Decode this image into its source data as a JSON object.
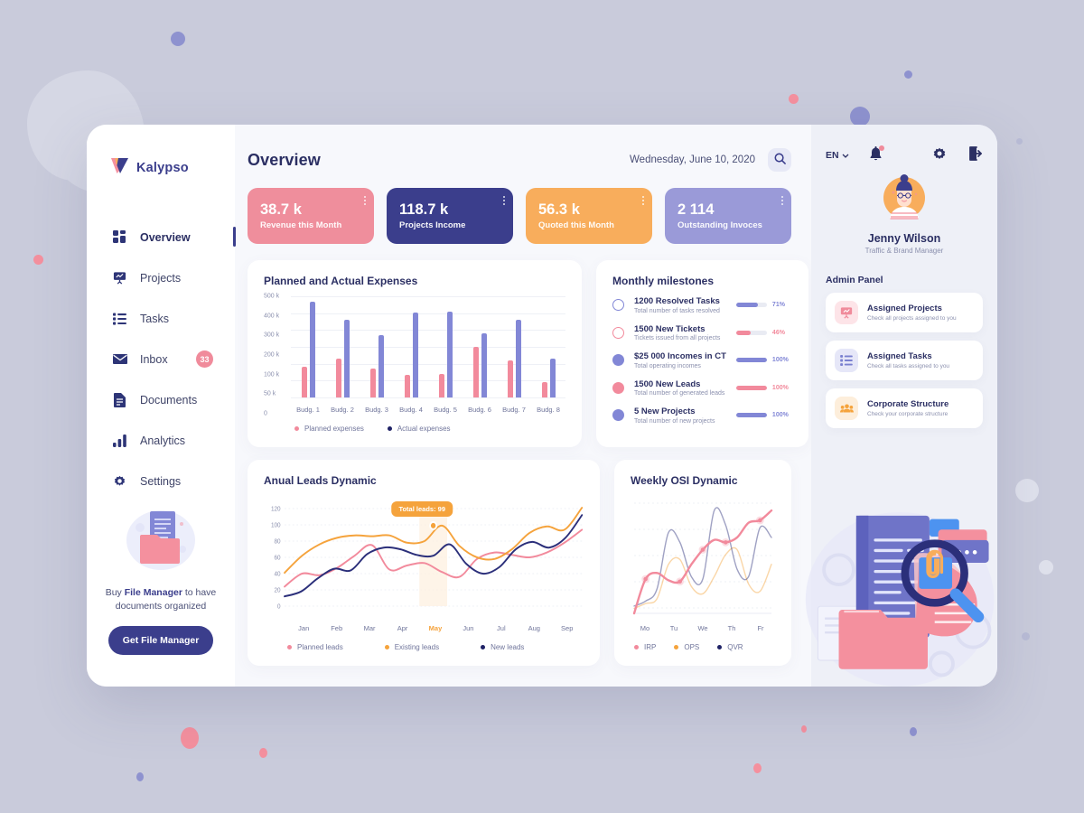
{
  "background": {
    "base_color": "#c9cbdb",
    "blob_color": "#d5d7e4"
  },
  "brand": {
    "name": "Kalypso",
    "logo_icon": "kalypso-v-logo"
  },
  "sidebar": {
    "items": [
      {
        "label": "Overview",
        "icon": "grid-icon",
        "active": true
      },
      {
        "label": "Projects",
        "icon": "presentation-icon",
        "active": false
      },
      {
        "label": "Tasks",
        "icon": "list-icon",
        "active": false
      },
      {
        "label": "Inbox",
        "icon": "envelope-icon",
        "active": false,
        "badge": "33"
      },
      {
        "label": "Documents",
        "icon": "document-icon",
        "active": false
      },
      {
        "label": "Analytics",
        "icon": "bar-chart-icon",
        "active": false
      },
      {
        "label": "Settings",
        "icon": "gear-icon",
        "active": false
      }
    ],
    "promo": {
      "art_icon": "file-manager-illustration",
      "text_before": "Buy ",
      "text_bold": "File Manager",
      "text_after": " to have documents organized",
      "button_label": "Get File Manager"
    }
  },
  "header": {
    "title": "Overview",
    "date": "Wednesday, June 10, 2020",
    "search_icon": "search-icon"
  },
  "kpis": [
    {
      "value": "38.7 k",
      "label": "Revenue this Month",
      "color": "#ef8e9c"
    },
    {
      "value": "118.7 k",
      "label": "Projects Income",
      "color": "#3b3e8c"
    },
    {
      "value": "56.3 k",
      "label": "Quoted this Month",
      "color": "#f8ad5c"
    },
    {
      "value": "2 114",
      "label": "Outstanding Invoces",
      "color": "#9a9ad8"
    }
  ],
  "milestones": {
    "title": "Monthly milestones",
    "items": [
      {
        "title": "1200 Resolved Tasks",
        "sub": "Total number of tasks resolved",
        "pct": 71,
        "pct_label": "71%",
        "color": "#8287d6",
        "filled": false
      },
      {
        "title": "1500 New Tickets",
        "sub": "Tickets issued from all projects",
        "pct": 46,
        "pct_label": "46%",
        "color": "#f28a9c",
        "filled": false
      },
      {
        "title": "$25 000 Incomes in CT",
        "sub": "Total operating incomes",
        "pct": 100,
        "pct_label": "100%",
        "color": "#8287d6",
        "filled": true
      },
      {
        "title": "1500 New Leads",
        "sub": "Total number of generated leads",
        "pct": 100,
        "pct_label": "100%",
        "color": "#f28a9c",
        "filled": true
      },
      {
        "title": "5 New Projects",
        "sub": "Total number of new projects",
        "pct": 100,
        "pct_label": "100%",
        "color": "#8287d6",
        "filled": true
      }
    ]
  },
  "right_panel": {
    "language": "EN",
    "chevron_icon": "chevron-down-icon",
    "bell_icon": "bell-icon",
    "gear_icon": "gear-icon",
    "logout_icon": "logout-icon",
    "user": {
      "name": "Jenny Wilson",
      "role": "Traffic & Brand Manager",
      "avatar_icon": "avatar-illustration"
    },
    "admin_heading": "Admin Panel",
    "admin_items": [
      {
        "title": "Assigned Projects",
        "sub": "Check all projects assigned to you",
        "icon": "presentation-icon",
        "bg": "#fde4e8",
        "fg": "#f08b9b"
      },
      {
        "title": "Assigned Tasks",
        "sub": "Check all tasks assigned to you",
        "icon": "list-icon",
        "bg": "#e6e7f8",
        "fg": "#7a80d0"
      },
      {
        "title": "Corporate Structure",
        "sub": "Check your corporate structure",
        "icon": "people-icon",
        "bg": "#fdeedb",
        "fg": "#f5a33c"
      }
    ],
    "illustration_icon": "document-search-illustration"
  },
  "chart_data": [
    {
      "type": "bar",
      "title": "Planned and Actual Expenses",
      "categories": [
        "Budg. 1",
        "Budg. 2",
        "Budg. 3",
        "Budg. 4",
        "Budg. 5",
        "Budg. 6",
        "Budg. 7",
        "Budg. 8"
      ],
      "series": [
        {
          "name": "Planned expenses",
          "color": "#f28a9c",
          "values": [
            90,
            128,
            85,
            68,
            69,
            200,
            118,
            45
          ]
        },
        {
          "name": "Actual expenses",
          "color": "#8287d6",
          "values": [
            470,
            362,
            268,
            405,
            407,
            278,
            362,
            128
          ]
        }
      ],
      "yticks": [
        "500 k",
        "400 k",
        "300 k",
        "200 k",
        "100 k",
        "50 k",
        "0"
      ],
      "ylim": [
        0,
        500
      ],
      "ylabel": "",
      "xlabel": "",
      "grid": true,
      "legend_position": "bottom",
      "legend_dot_colors": {
        "Planned expenses": "#f28a9c",
        "Actual expenses": "#1f2266"
      }
    },
    {
      "type": "line",
      "title": "Anual Leads Dynamic",
      "x": [
        "Jan",
        "Feb",
        "Mar",
        "Apr",
        "May",
        "Jun",
        "Jul",
        "Aug",
        "Sep"
      ],
      "highlight_x": "May",
      "yticks": [
        "120",
        "100",
        "80",
        "60",
        "40",
        "20",
        "0"
      ],
      "ylim": [
        0,
        120
      ],
      "grid": true,
      "annotation": {
        "text": "Total leads: 99",
        "x": "May",
        "y": 99,
        "color": "#f5a33c"
      },
      "series": [
        {
          "name": "Planned leads",
          "color": "#f28a9c",
          "values": [
            24,
            40,
            38,
            47,
            62,
            75,
            45,
            50,
            53,
            42,
            36,
            58,
            66,
            63,
            60,
            66,
            78,
            94
          ]
        },
        {
          "name": "Existing leads",
          "color": "#f5a33c",
          "values": [
            41,
            62,
            76,
            84,
            87,
            86,
            87,
            78,
            80,
            99,
            74,
            60,
            58,
            70,
            90,
            98,
            94,
            121
          ]
        },
        {
          "name": "New leads",
          "color": "#2b2f7a",
          "values": [
            12,
            18,
            34,
            46,
            44,
            64,
            72,
            70,
            63,
            62,
            76,
            52,
            40,
            48,
            70,
            79,
            72,
            84,
            112
          ]
        }
      ],
      "legend_position": "bottom"
    },
    {
      "type": "line",
      "title": "Weekly OSI Dynamic",
      "x": [
        "Mo",
        "Tu",
        "We",
        "Th",
        "Fr"
      ],
      "grid": true,
      "series": [
        {
          "name": "IRP",
          "color": "#f28a9c",
          "values": [
            0,
            28,
            33,
            27,
            26,
            40,
            52,
            60,
            58,
            62,
            74,
            76,
            84
          ]
        },
        {
          "name": "OPS",
          "color": "#f5a33c",
          "values": [
            4,
            8,
            12,
            40,
            44,
            22,
            16,
            30,
            48,
            52,
            24,
            18,
            40
          ]
        },
        {
          "name": "QVR",
          "color": "#2b2f7a",
          "values": [
            6,
            10,
            20,
            66,
            58,
            30,
            28,
            84,
            72,
            36,
            30,
            70,
            62
          ]
        }
      ],
      "markers_series": "IRP",
      "legend_position": "bottom"
    }
  ]
}
